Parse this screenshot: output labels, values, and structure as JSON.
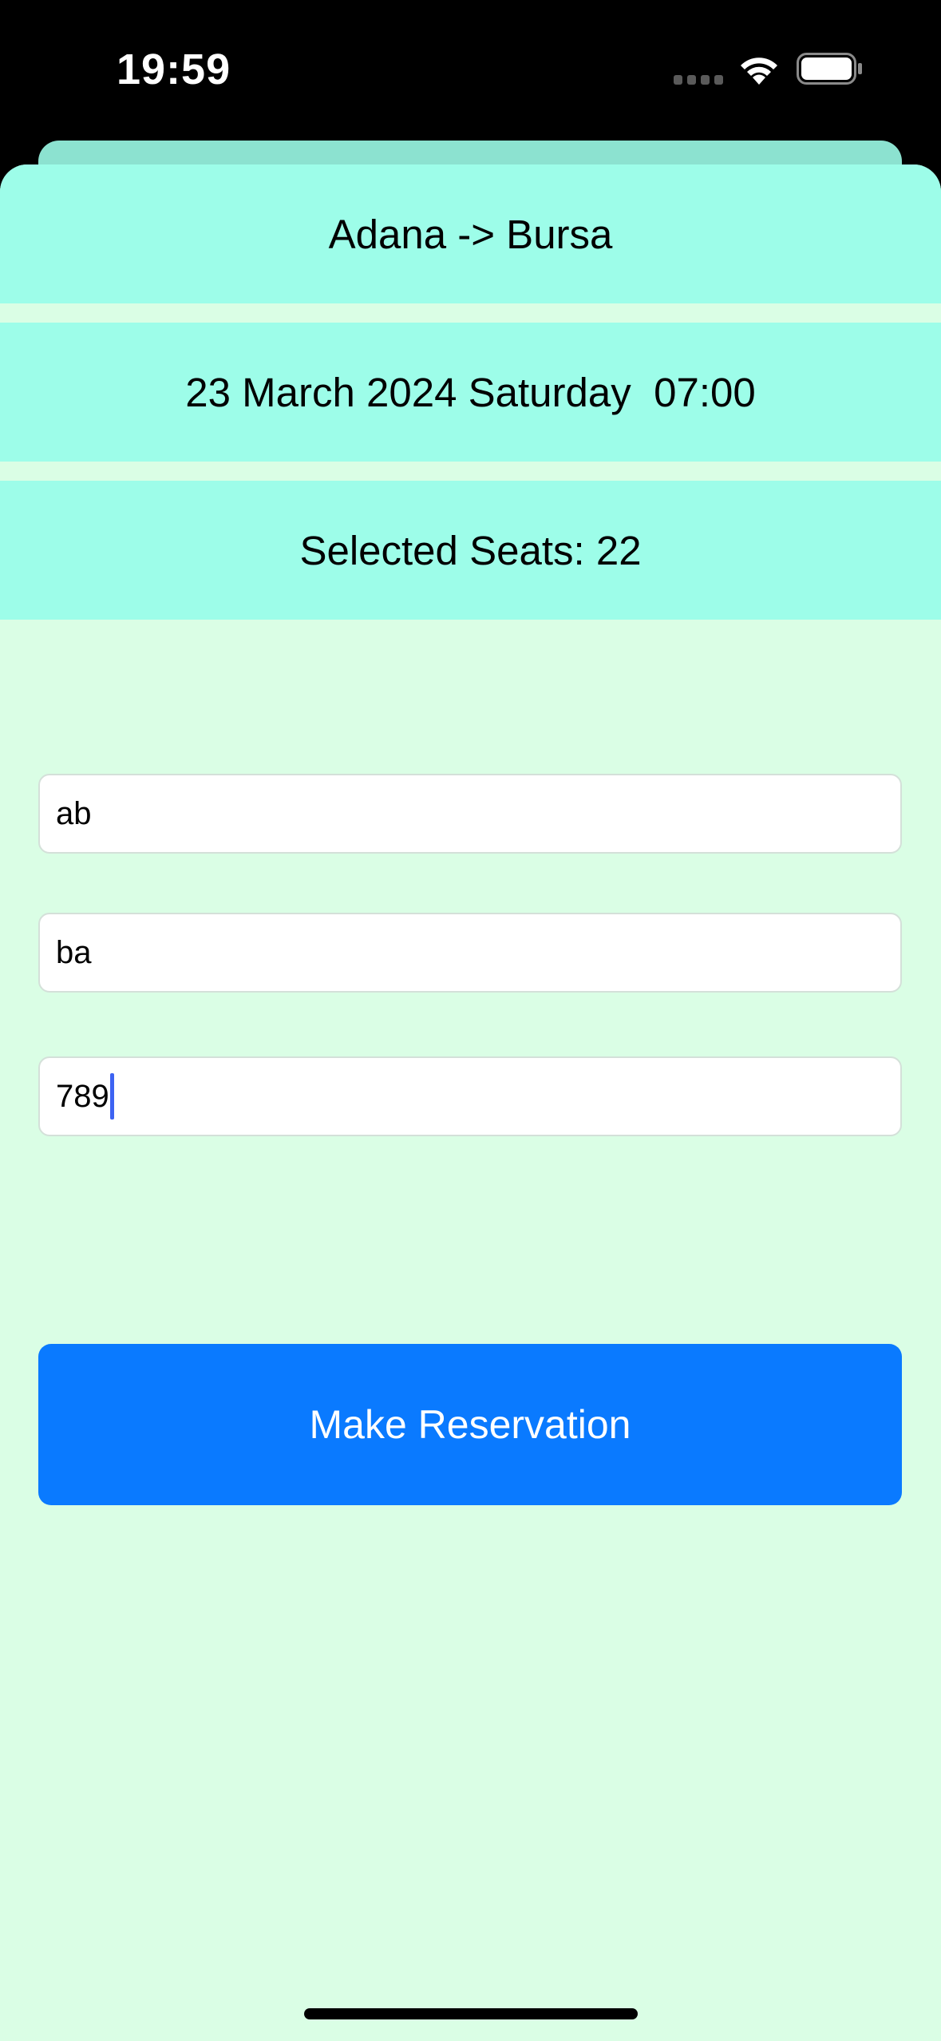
{
  "status_bar": {
    "time": "19:59",
    "icons": [
      "signal-dots-icon",
      "wifi-icon",
      "battery-icon"
    ]
  },
  "trip": {
    "route": "Adana -> Bursa",
    "datetime": "23 March 2024 Saturday  07:00",
    "selected_seats": "Selected Seats: 22"
  },
  "form": {
    "field_1_value": "ab",
    "field_2_value": "ba",
    "field_3_value": "789"
  },
  "actions": {
    "reserve_label": "Make Reservation"
  },
  "colors": {
    "background": "#dafee5",
    "info_row": "#9dfde9",
    "button": "#0a7aff",
    "caret": "#3d63f2"
  }
}
